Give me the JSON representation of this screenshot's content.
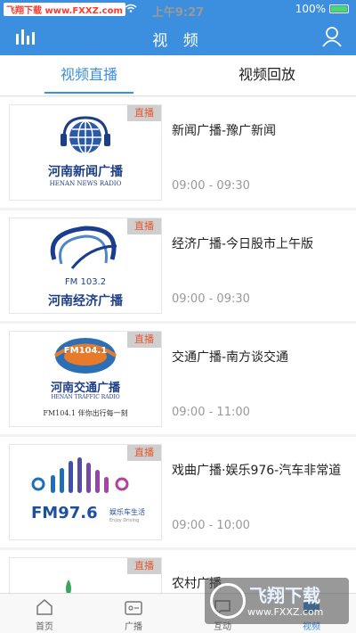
{
  "status_bar": {
    "watermark": "飞翔下载 www.FXXZ.com",
    "time": "上午9:27",
    "battery": "100%"
  },
  "header": {
    "title": "视 频"
  },
  "tabs": [
    {
      "label": "视频直播",
      "active": true
    },
    {
      "label": "视频回放",
      "active": false
    }
  ],
  "items": [
    {
      "badge": "直播",
      "name": "新闻广播-豫广新闻",
      "time": "09:00 - 09:30",
      "logo": {
        "cn": "河南新闻广播",
        "en": "HENAN NEWS RADIO"
      }
    },
    {
      "badge": "直播",
      "name": "经济广播-今日股市上午版",
      "time": "09:00 - 09:30",
      "logo": {
        "fm": "FM 103.2",
        "cn": "河南经济广播"
      }
    },
    {
      "badge": "直播",
      "name": "交通广播-南方谈交通",
      "time": "09:00 - 11:00",
      "logo": {
        "fm": "FM104.1",
        "cn": "河南交通广播",
        "en": "HENAN TRAFFIC RADIO",
        "slogan": "FM104.1 伴你出行每一刻"
      }
    },
    {
      "badge": "直播",
      "name": "戏曲广播·娱乐976-汽车非常道",
      "time": "09:00 - 10:00",
      "logo": {
        "fm": "FM97.6",
        "tag": "娱乐车生活",
        "tag_en": "Enjoy Driving"
      }
    },
    {
      "badge": "直播",
      "name": "农村广播",
      "time": ""
    }
  ],
  "bottom_nav": [
    {
      "label": "首页",
      "icon": "home-icon",
      "active": false
    },
    {
      "label": "广播",
      "icon": "radio-icon",
      "active": false
    },
    {
      "label": "互动",
      "icon": "chat-icon",
      "active": false
    },
    {
      "label": "视频",
      "icon": "video-icon",
      "active": true
    }
  ],
  "watermark": {
    "brand": "飞翔下载",
    "url": "www.FXXZ.com"
  },
  "colors": {
    "primary": "#3c8fde",
    "badge_text": "#e5572e",
    "badge_bg": "#cfcfcf"
  }
}
